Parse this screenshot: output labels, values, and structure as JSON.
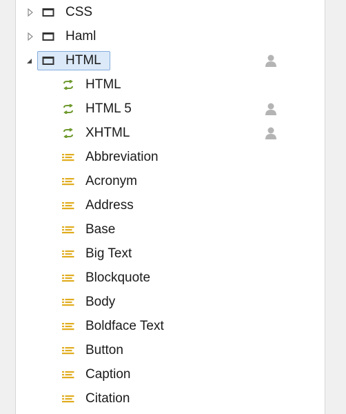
{
  "tree": {
    "folders": [
      {
        "label": "CSS",
        "expanded": false
      },
      {
        "label": "Haml",
        "expanded": false
      },
      {
        "label": "HTML",
        "expanded": true,
        "selected": true,
        "user_marker": true
      }
    ],
    "templates": [
      {
        "label": "HTML",
        "user_marker": false
      },
      {
        "label": "HTML 5",
        "user_marker": true
      },
      {
        "label": "XHTML",
        "user_marker": true
      }
    ],
    "snippets": [
      "Abbreviation",
      "Acronym",
      "Address",
      "Base",
      "Big Text",
      "Blockquote",
      "Body",
      "Boldface Text",
      "Button",
      "Caption",
      "Citation"
    ]
  },
  "colors": {
    "template_icon": "#6f9a2e",
    "snippet_icon": "#e0ac1e",
    "person_icon": "#b4b4b4",
    "selection_bg": "#dbe9f8",
    "selection_border": "#84acdd"
  }
}
